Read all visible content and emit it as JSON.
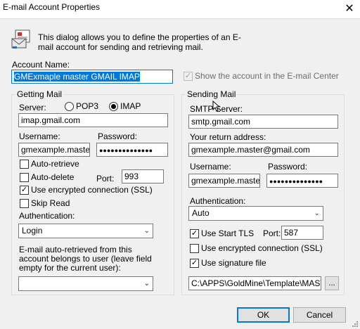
{
  "window": {
    "title": "E-mail Account Properties",
    "close_glyph": "✕"
  },
  "header": {
    "icon": "email-account-icon",
    "description": "This dialog allows you to define the properties of an E-mail account for sending and retrieving mail."
  },
  "account": {
    "name_label": "Account Name:",
    "name_value": "GMExmaple master GMAIL IMAP",
    "show_in_center_label": "Show the account in the E-mail Center",
    "show_in_center_checked": true
  },
  "getting_mail": {
    "title": "Getting Mail",
    "server_label": "Server:",
    "pop3_label": "POP3",
    "imap_label": "IMAP",
    "protocol_selected": "IMAP",
    "server_value": "imap.gmail.com",
    "username_label": "Username:",
    "username_value": "gmexample.master@",
    "password_label": "Password:",
    "password_value": "●●●●●●●●●●●●●●",
    "auto_retrieve_label": "Auto-retrieve",
    "auto_retrieve_checked": false,
    "auto_delete_label": "Auto-delete",
    "auto_delete_checked": false,
    "port_label": "Port:",
    "port_value": "993",
    "ssl_label": "Use encrypted connection (SSL)",
    "ssl_checked": true,
    "skip_read_label": "Skip Read",
    "skip_read_checked": false,
    "auth_label": "Authentication:",
    "auth_value": "Login",
    "user_note": "E-mail auto-retrieved from this account belongs to user (leave field empty for the current user):",
    "user_value": ""
  },
  "sending_mail": {
    "title": "Sending Mail",
    "smtp_label": "SMTP Server:",
    "smtp_value": "smtp.gmail.com",
    "return_label": "Your return address:",
    "return_value": "gmexample.master@gmail.com",
    "username_label": "Username:",
    "username_value": "gmexample.master@",
    "password_label": "Password:",
    "password_value": "●●●●●●●●●●●●●●",
    "auth_label": "Authentication:",
    "auth_value": "Auto",
    "tls_label": "Use Start TLS",
    "tls_checked": true,
    "port_label": "Port:",
    "port_value": "587",
    "ssl_label": "Use encrypted connection (SSL)",
    "ssl_checked": false,
    "signature_label": "Use signature file",
    "signature_checked": true,
    "signature_path": "C:\\APPS\\GoldMine\\Template\\MASTE",
    "browse_label": "..."
  },
  "buttons": {
    "ok": "OK",
    "cancel": "Cancel"
  },
  "colors": {
    "accent": "#0078d7",
    "dialog_bg": "#f0f0f0"
  }
}
